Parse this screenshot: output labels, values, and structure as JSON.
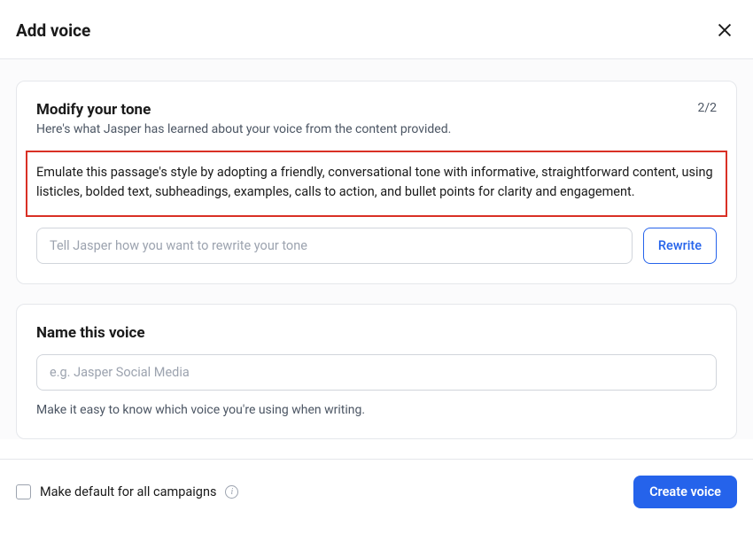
{
  "header": {
    "title": "Add voice"
  },
  "tone_card": {
    "title": "Modify your tone",
    "subtitle": "Here's what Jasper has learned about your voice from the content provided.",
    "step_indicator": "2/2",
    "highlighted_text": "Emulate this passage's style by adopting a friendly, conversational tone with informative, straightforward content, using listicles, bolded text, subheadings, examples, calls to action, and bullet points for clarity and engagement.",
    "input_placeholder": "Tell Jasper how you want to rewrite your tone",
    "rewrite_label": "Rewrite"
  },
  "name_card": {
    "title": "Name this voice",
    "input_placeholder": "e.g. Jasper Social Media",
    "helper_text": "Make it easy to know which voice you're using when writing."
  },
  "footer": {
    "checkbox_label": "Make default for all campaigns",
    "create_label": "Create voice"
  }
}
